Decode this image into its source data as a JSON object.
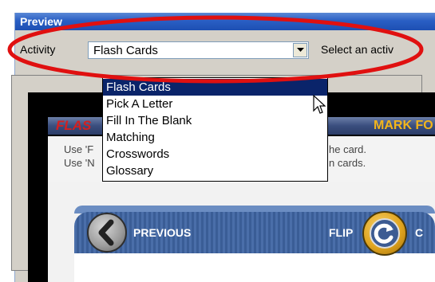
{
  "window": {
    "title": "Preview"
  },
  "activity": {
    "label": "Activity",
    "selected": "Flash Cards",
    "hint": "Select an activ",
    "options": [
      "Flash Cards",
      "Pick A Letter",
      "Fill In The Blank",
      "Matching",
      "Crosswords",
      "Glossary"
    ]
  },
  "banner": {
    "left": "FLAS",
    "right": "MARK FO"
  },
  "instructions": {
    "line1_start": "Use 'F",
    "line1_end": "he card.",
    "line2_start": "Use 'N",
    "line2_end": "n cards."
  },
  "card": {
    "previous_label": "PREVIOUS",
    "flip_label": "FLIP",
    "next_partial": "C"
  },
  "colors": {
    "title_bar": "#2a5fc4",
    "selected_option": "#0a246a",
    "highlight_ring": "#e01010",
    "banner_accent": "#f3b51b"
  },
  "icons": [
    "dropdown-arrow-icon",
    "mouse-cursor-icon",
    "previous-arrow-icon",
    "flip-icon"
  ]
}
